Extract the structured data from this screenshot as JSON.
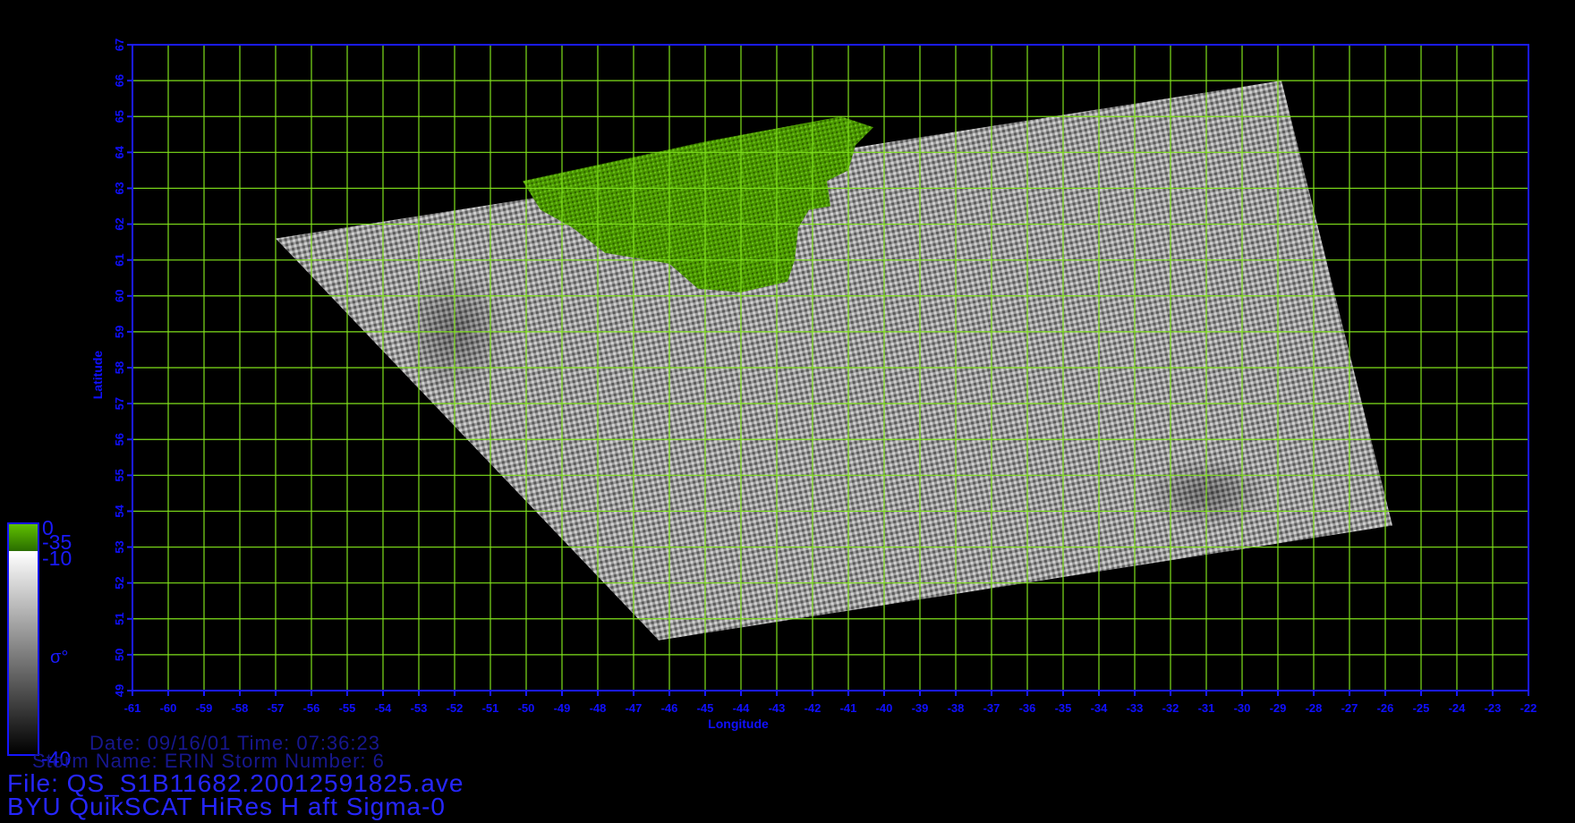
{
  "chart_data": {
    "type": "heatmap",
    "xlabel": "Longitude",
    "ylabel": "Latitude",
    "xlim": [
      -61,
      -22
    ],
    "ylim": [
      49,
      67
    ],
    "x_ticks": [
      -61,
      -60,
      -59,
      -58,
      -57,
      -56,
      -55,
      -54,
      -53,
      -52,
      -51,
      -50,
      -49,
      -48,
      -47,
      -46,
      -45,
      -44,
      -43,
      -42,
      -41,
      -40,
      -39,
      -38,
      -37,
      -36,
      -35,
      -34,
      -33,
      -32,
      -31,
      -30,
      -29,
      -28,
      -27,
      -26,
      -25,
      -24,
      -23,
      -22
    ],
    "y_ticks": [
      49,
      50,
      51,
      52,
      53,
      54,
      55,
      56,
      57,
      58,
      59,
      60,
      61,
      62,
      63,
      64,
      65,
      66,
      67
    ],
    "grid": true,
    "grid_color": "#7fe01b",
    "axis_color": "#1a1aff",
    "swath_corners": [
      [
        -57,
        61.6
      ],
      [
        -28.9,
        66
      ],
      [
        -25.8,
        53.6
      ],
      [
        -46.3,
        50.4
      ]
    ],
    "land_region_color": "#4c9c00",
    "colorbar": {
      "labels": [
        "0",
        "-35",
        "-10",
        "-40"
      ],
      "symbol": "σ°",
      "colors": [
        "#60c000",
        "#2a6d00",
        "#ffffff",
        "#000000"
      ]
    }
  },
  "info": {
    "date_line": "Date: 09/16/01  Time: 07:36:23",
    "storm_line": "Storm Name: ERIN  Storm Number: 6",
    "file_line": "File: QS_S1B11682.20012591825.ave",
    "title_line": "BYU QuikSCAT HiRes H aft Sigma-0"
  }
}
